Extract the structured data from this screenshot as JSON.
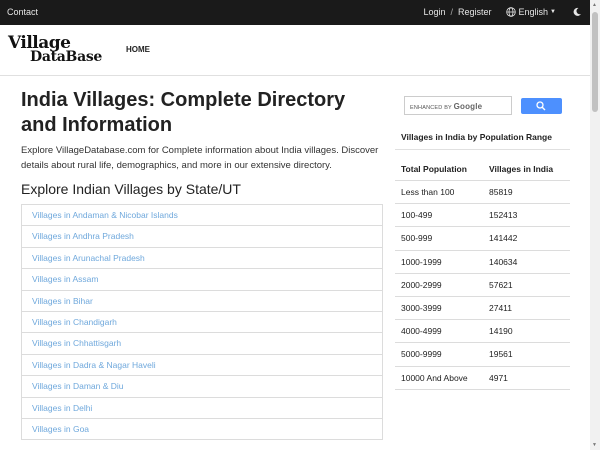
{
  "topbar": {
    "contact": "Contact",
    "login": "Login",
    "separator": "/",
    "register": "Register",
    "language": "English",
    "icons": [
      "globe-icon",
      "caret-down-icon",
      "moon-icon"
    ]
  },
  "navbar": {
    "logo_line1": "Village",
    "logo_line2": "DataBase",
    "home": "HOME"
  },
  "main": {
    "title": "India Villages: Complete Directory and Information",
    "intro": "Explore VillageDatabase.com for Complete information about India villages. Discover details about rural life, demographics, and more in our extensive directory.",
    "section_heading": "Explore Indian Villages by State/UT",
    "states": [
      "Villages in Andaman & Nicobar Islands",
      "Villages in Andhra Pradesh",
      "Villages in Arunachal Pradesh",
      "Villages in Assam",
      "Villages in Bihar",
      "Villages in Chandigarh",
      "Villages in Chhattisgarh",
      "Villages in Dadra & Nagar Haveli",
      "Villages in Daman & Diu",
      "Villages in Delhi",
      "Villages in Goa"
    ]
  },
  "sidebar": {
    "search_placeholder": "ENHANCED BY",
    "search_brand": "Google",
    "heading": "Villages in India by Population Range",
    "table": {
      "headers": [
        "Total Population",
        "Villages in India"
      ],
      "rows": [
        [
          "Less than 100",
          "85819"
        ],
        [
          "100-499",
          "152413"
        ],
        [
          "500-999",
          "141442"
        ],
        [
          "1000-1999",
          "140634"
        ],
        [
          "2000-2999",
          "57621"
        ],
        [
          "3000-3999",
          "27411"
        ],
        [
          "4000-4999",
          "14190"
        ],
        [
          "5000-9999",
          "19561"
        ],
        [
          "10000 And Above",
          "4971"
        ]
      ]
    }
  },
  "colors": {
    "topbar_bg": "#1a1a1a",
    "link": "#6fa8dc",
    "search_button": "#4d90fe"
  }
}
